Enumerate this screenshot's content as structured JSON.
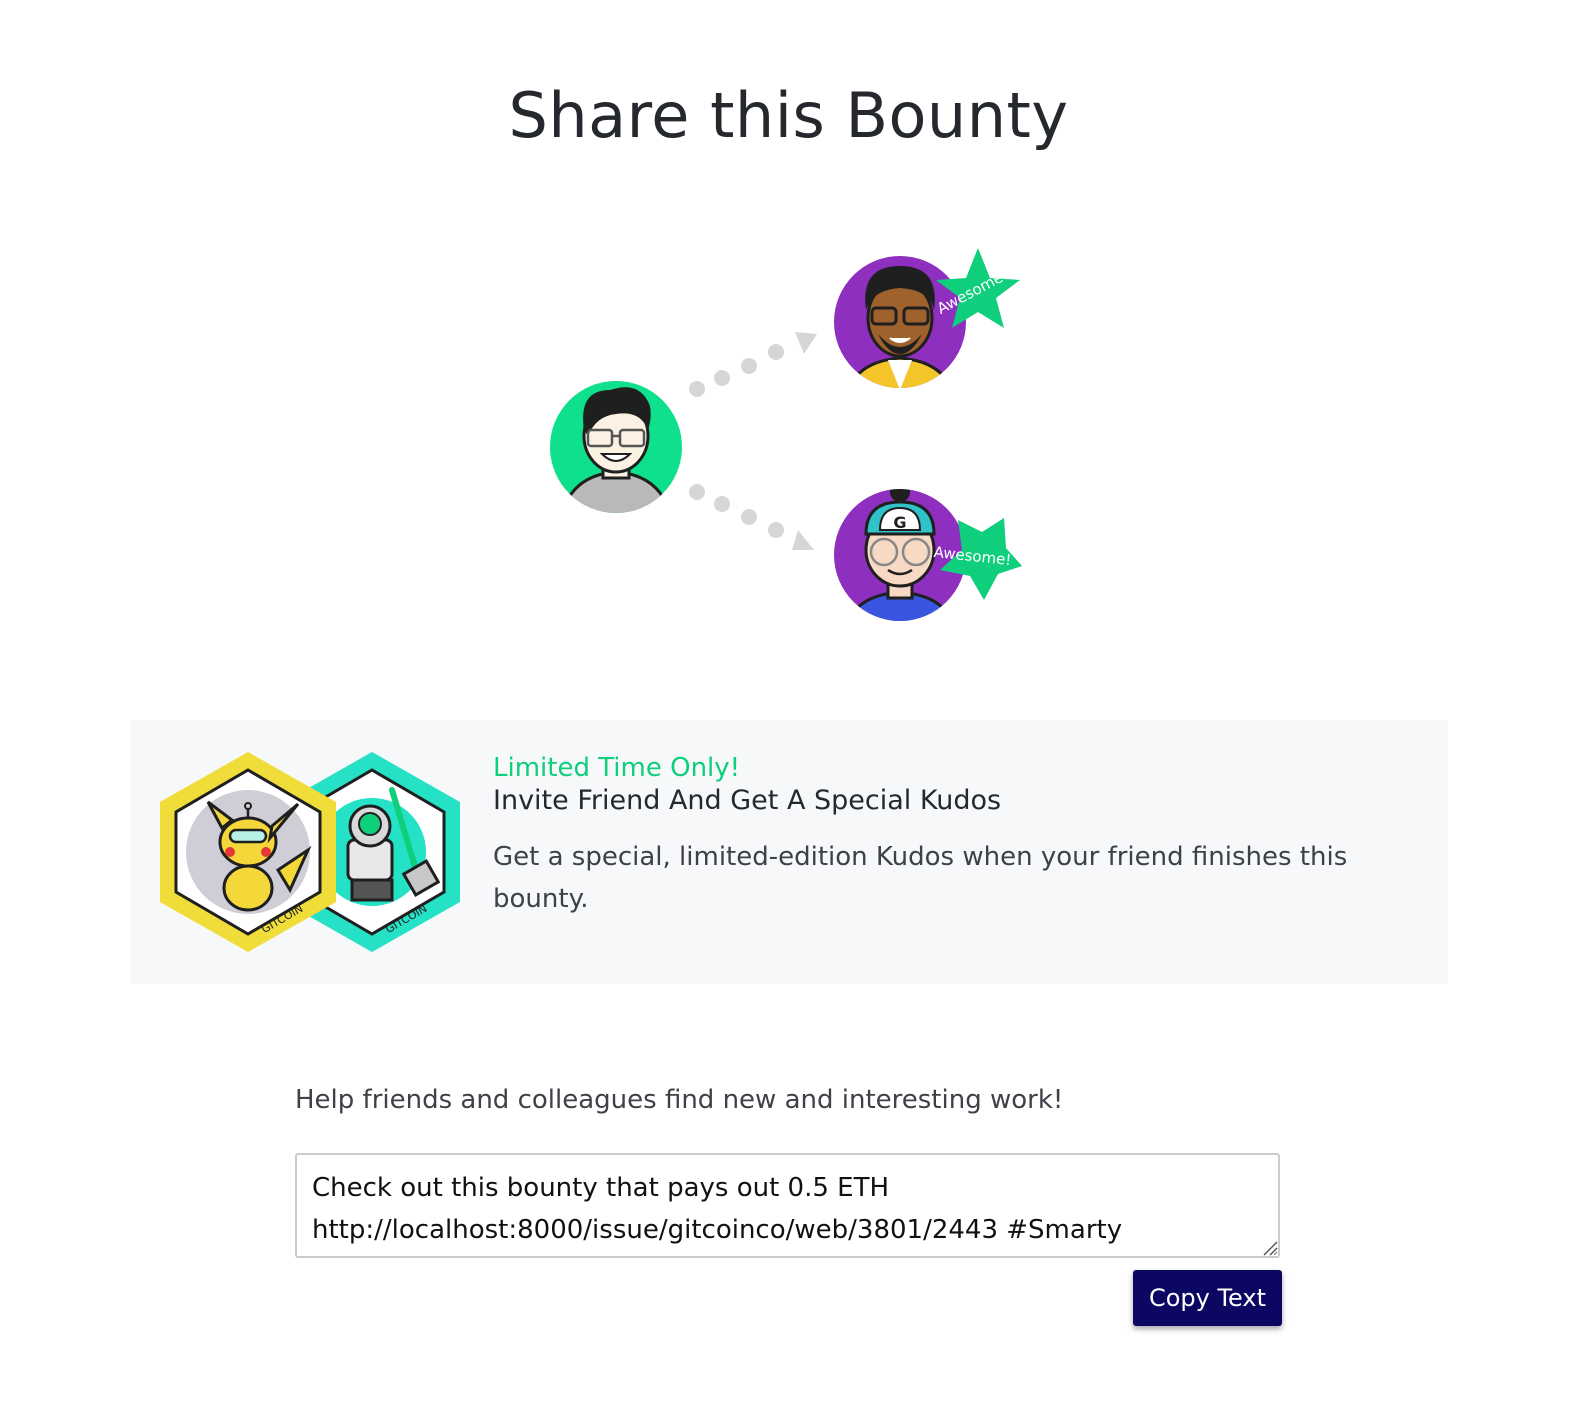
{
  "page": {
    "title": "Share this Bounty"
  },
  "illustration": {
    "badge_top": "Awesome!",
    "badge_bottom": "Awesome!",
    "cap_logo": "G"
  },
  "promo": {
    "eyebrow": "Limited Time Only!",
    "heading": "Invite Friend And Get A Special Kudos",
    "body": "Get a special, limited-edition Kudos when your friend finishes this bounty.",
    "badge_left_text": "GITCOIN",
    "badge_right_text": "GITCOIN"
  },
  "share": {
    "help_text": "Help friends and colleagues find new and interesting work!",
    "message_line1": "Check out this bounty that pays out 0.5 ETH",
    "message_line2": "http://localhost:8000/issue/gitcoinco/web/3801/2443  #Smarty",
    "copy_label": "Copy Text"
  },
  "colors": {
    "accent_green": "#0fce7c",
    "button_navy": "#0d0764",
    "avatar_purple": "#8e2fbf",
    "avatar_green": "#0ee08b",
    "badge_yellow": "#f1dd3a",
    "badge_teal": "#25e2c6"
  }
}
